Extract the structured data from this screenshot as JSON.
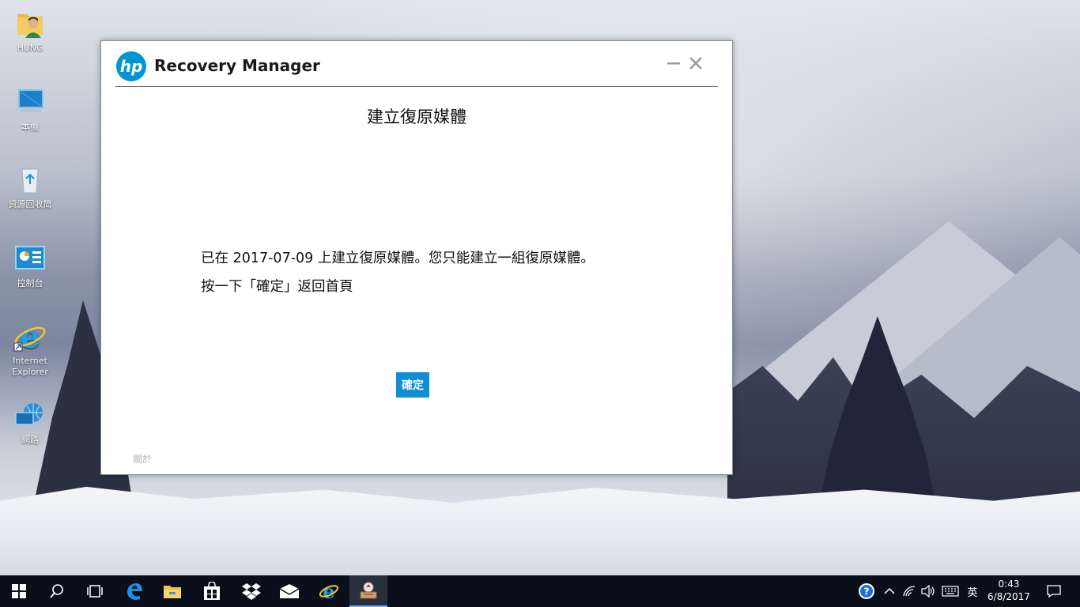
{
  "desktop": {
    "icons": [
      {
        "label": "HUNG"
      },
      {
        "label": "本機"
      },
      {
        "label": "資源回收筒"
      },
      {
        "label": "控制台"
      },
      {
        "label": "Internet Explorer"
      },
      {
        "label": "網路"
      }
    ]
  },
  "window": {
    "app_title": "Recovery Manager",
    "logo_text": "hp",
    "page_title": "建立復原媒體",
    "message_prefix": "已在 ",
    "message_date": "2017-07-09",
    "message_suffix": " 上建立復原媒體。您只能建立一組復原媒體。",
    "instruction": "按一下「確定」返回首頁",
    "ok_label": "確定",
    "about_label": "關於"
  },
  "taskbar": {
    "ime_label": "英",
    "time": "0:43",
    "date": "6/8/2017"
  },
  "colors": {
    "accent": "#0e8ed3",
    "hp_blue": "#0096d6",
    "taskbar": "#0b0f1b"
  }
}
